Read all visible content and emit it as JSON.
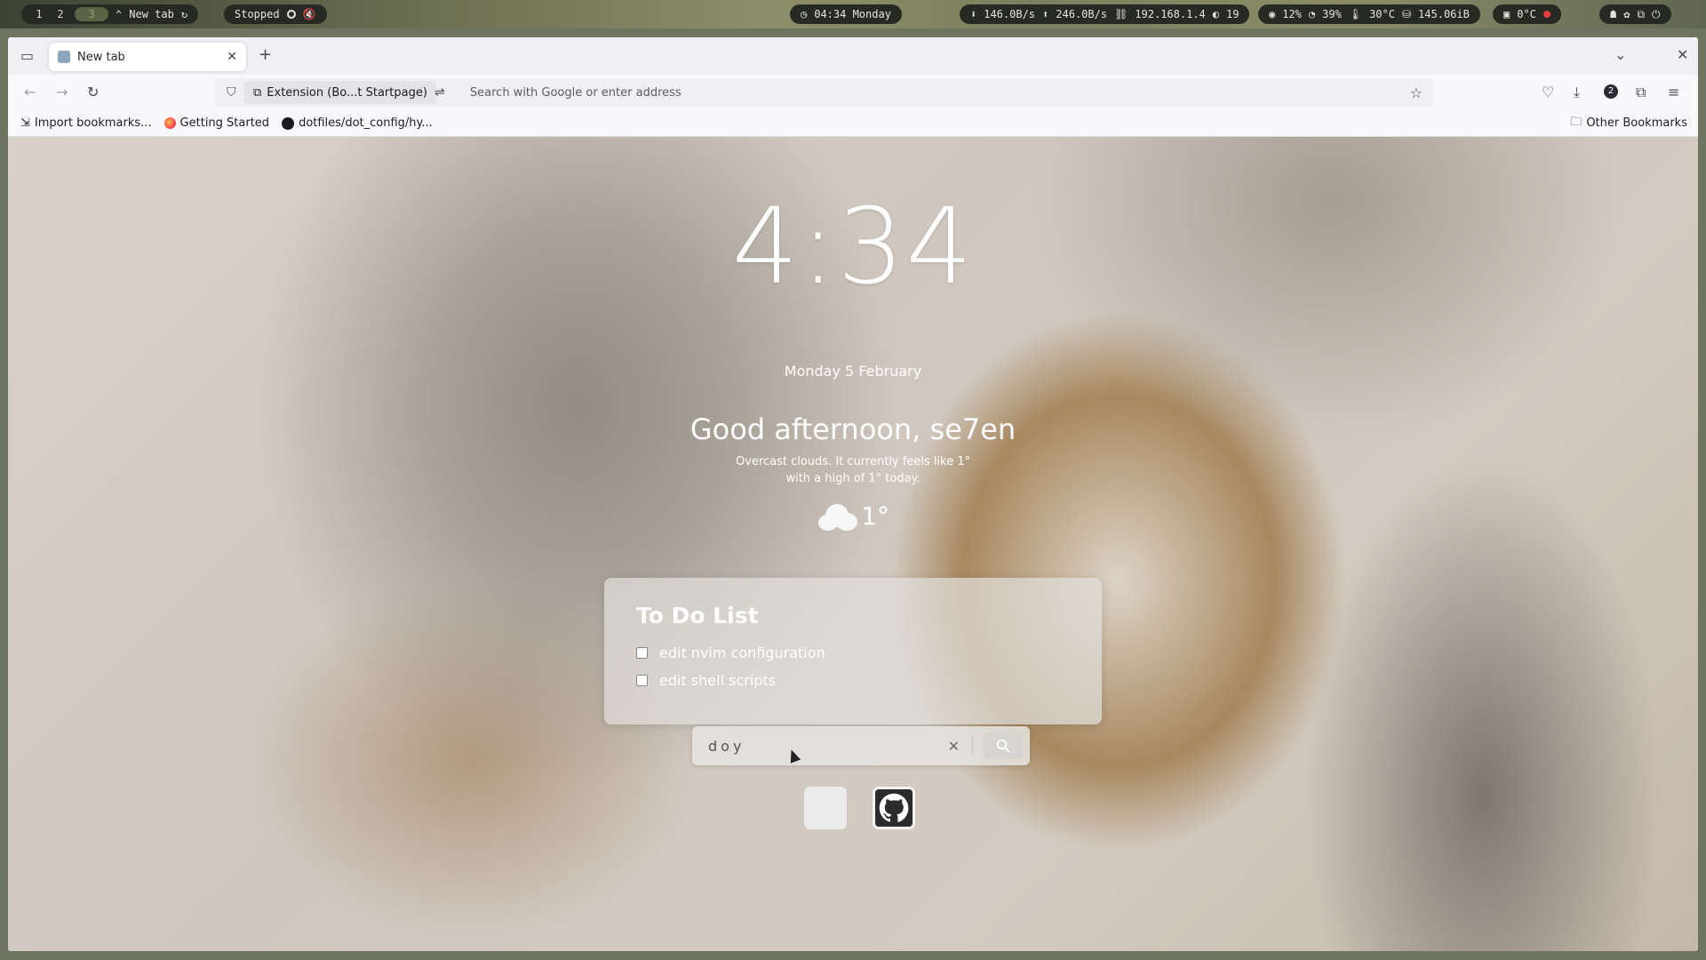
{
  "topbar": {
    "workspaces": [
      "1",
      "2",
      "3"
    ],
    "window_title": "New tab",
    "media_status": "Stopped",
    "clock": "04:34 Monday",
    "network": {
      "down": "146.0B/s",
      "up": "246.0B/s",
      "ip": "192.168.1.4",
      "signal": "19"
    },
    "system": {
      "cpu": "12%",
      "memory": "39%",
      "temp": "30°C",
      "disk": "145.06iB"
    },
    "weather": "0°C"
  },
  "browser": {
    "tab_title": "New tab",
    "extension_chip": "Extension (Bo...t Startpage)",
    "url_placeholder": "Search with Google or enter address",
    "badge_count": "2",
    "bookmarks": [
      "Import bookmarks...",
      "Getting Started",
      "dotfiles/dot_config/hy..."
    ],
    "other_bookmarks": "Other Bookmarks"
  },
  "startpage": {
    "time": "4:34",
    "date": "Monday 5 February",
    "greeting": "Good afternoon, se7en",
    "weather_line1": "Overcast clouds. It currently feels like 1°",
    "weather_line2": "with a high of 1° today.",
    "temperature": "1°",
    "weather_icon": "cloud-icon",
    "todo": {
      "title": "To Do List",
      "items": [
        "edit nvim configuration",
        "edit shell scripts"
      ]
    },
    "search_value": "doy",
    "quick_links": [
      "blank-tile",
      "github-icon"
    ]
  }
}
